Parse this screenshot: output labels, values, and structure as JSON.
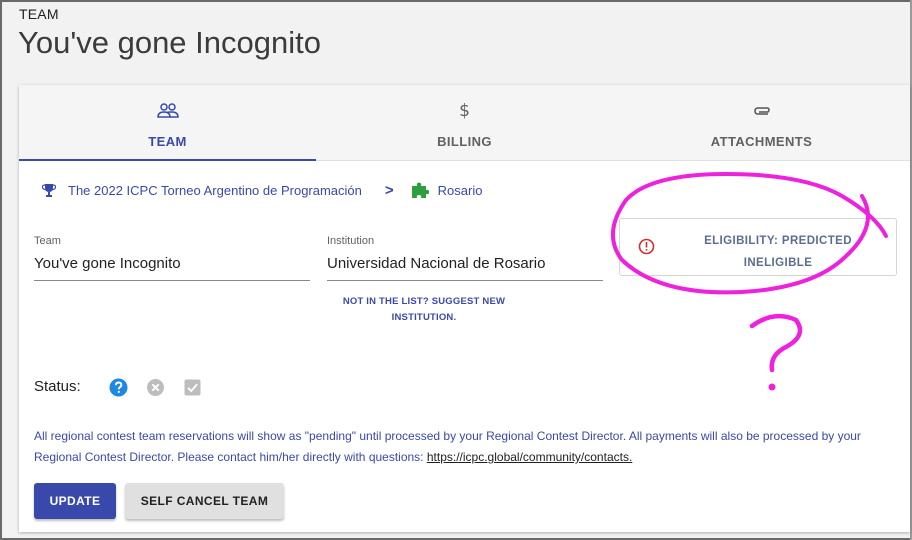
{
  "header": {
    "label": "TEAM",
    "title": "You've gone Incognito"
  },
  "tabs": [
    {
      "label": "TEAM",
      "icon": "team-icon",
      "active": true
    },
    {
      "label": "BILLING",
      "icon": "dollar-icon",
      "active": false
    },
    {
      "label": "ATTACHMENTS",
      "icon": "paperclip-icon",
      "active": false
    }
  ],
  "billing_symbol": "$",
  "breadcrumb": {
    "contest": "The 2022 ICPC Torneo Argentino de Programación",
    "separator": ">",
    "site": "Rosario"
  },
  "form": {
    "team_label": "Team",
    "team_value": "You've gone Incognito",
    "institution_label": "Institution",
    "institution_value": "Universidad Nacional de Rosario",
    "suggest_line1": "NOT IN THE LIST? SUGGEST NEW",
    "suggest_line2": "INSTITUTION."
  },
  "eligibility": {
    "line1": "ELIGIBILITY: PREDICTED",
    "line2": "INELIGIBLE",
    "color": "#d32f2f"
  },
  "status": {
    "label": "Status:",
    "icons": [
      "help-circle-icon",
      "cancel-circle-icon",
      "checkbox-icon"
    ]
  },
  "notice": {
    "text": "All regional contest team reservations will show as \"pending\" until processed by your Regional Contest Director. All payments will also be processed by your Regional Contest Director. Please contact him/her directly with questions: ",
    "link": "https://icpc.global/community/contacts."
  },
  "buttons": {
    "update": "UPDATE",
    "self_cancel": "SELF CANCEL TEAM"
  },
  "annotation": {
    "mark": "?",
    "color": "#ee22dd"
  },
  "colors": {
    "primary": "#3949ab",
    "trophy": "#3949ab",
    "puzzle": "#2e9e3e",
    "help": "#1e88e5"
  }
}
